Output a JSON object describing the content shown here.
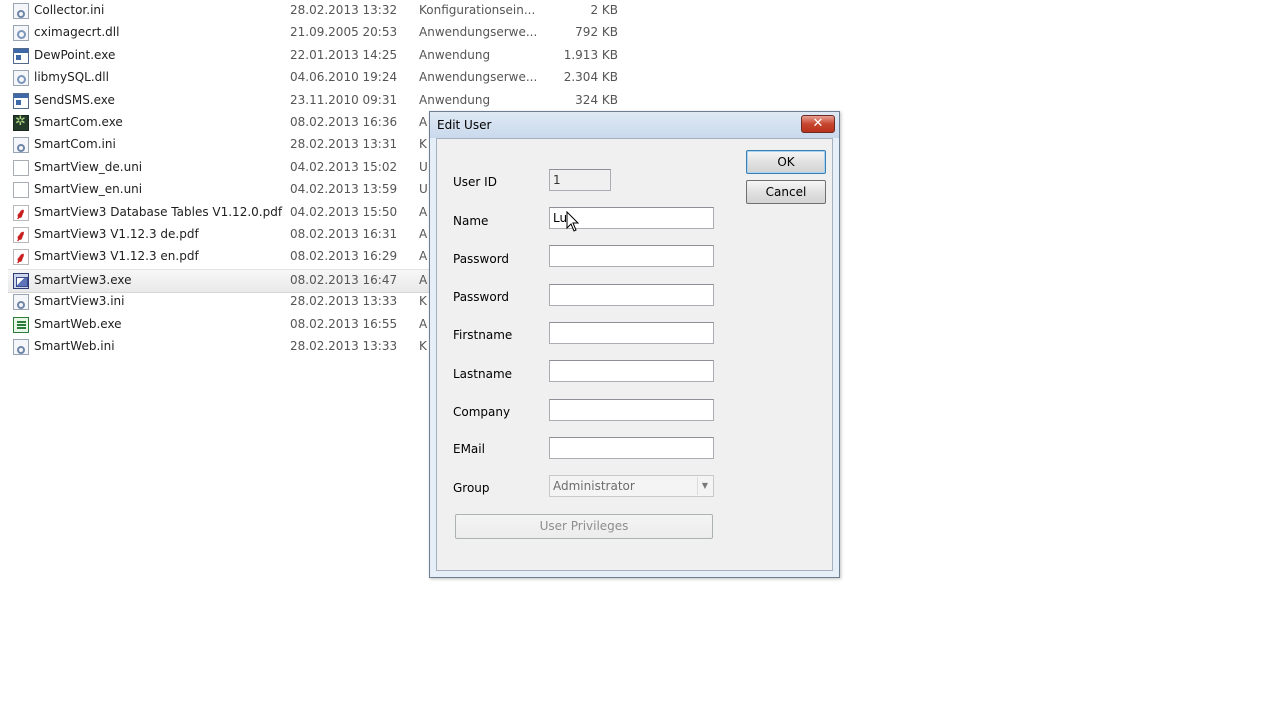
{
  "files": [
    {
      "name": "Collector.ini",
      "date": "28.02.2013 13:32",
      "type": "Konfigurationsein...",
      "size": "2 KB",
      "icon": "ini-file-icon"
    },
    {
      "name": "cximagecrt.dll",
      "date": "21.09.2005 20:53",
      "type": "Anwendungserwe...",
      "size": "792 KB",
      "icon": "dll-file-icon"
    },
    {
      "name": "DewPoint.exe",
      "date": "22.01.2013 14:25",
      "type": "Anwendung",
      "size": "1.913 KB",
      "icon": "exe-file-icon"
    },
    {
      "name": "libmySQL.dll",
      "date": "04.06.2010 19:24",
      "type": "Anwendungserwe...",
      "size": "2.304 KB",
      "icon": "dll-file-icon"
    },
    {
      "name": "SendSMS.exe",
      "date": "23.11.2010 09:31",
      "type": "Anwendung",
      "size": "324 KB",
      "icon": "exe-file-icon"
    },
    {
      "name": "SmartCom.exe",
      "date": "08.02.2013 16:36",
      "type": "A",
      "size": "",
      "icon": "smartcom-app-icon"
    },
    {
      "name": "SmartCom.ini",
      "date": "28.02.2013 13:31",
      "type": "K",
      "size": "",
      "icon": "ini-file-icon"
    },
    {
      "name": "SmartView_de.uni",
      "date": "04.02.2013 15:02",
      "type": "U",
      "size": "",
      "icon": "uni-file-icon"
    },
    {
      "name": "SmartView_en.uni",
      "date": "04.02.2013 13:59",
      "type": "U",
      "size": "",
      "icon": "uni-file-icon"
    },
    {
      "name": "SmartView3 Database Tables V1.12.0.pdf",
      "date": "04.02.2013 15:50",
      "type": "A",
      "size": "",
      "icon": "pdf-file-icon"
    },
    {
      "name": "SmartView3 V1.12.3 de.pdf",
      "date": "08.02.2013 16:31",
      "type": "A",
      "size": "",
      "icon": "pdf-file-icon"
    },
    {
      "name": "SmartView3 V1.12.3 en.pdf",
      "date": "08.02.2013 16:29",
      "type": "A",
      "size": "",
      "icon": "pdf-file-icon"
    },
    {
      "name": "SmartView3.exe",
      "date": "08.02.2013 16:47",
      "type": "A",
      "size": "",
      "icon": "smartview-app-icon",
      "selected": true
    },
    {
      "name": "SmartView3.ini",
      "date": "28.02.2013 13:33",
      "type": "K",
      "size": "",
      "icon": "ini-file-icon"
    },
    {
      "name": "SmartWeb.exe",
      "date": "08.02.2013 16:55",
      "type": "A",
      "size": "",
      "icon": "smartweb-app-icon"
    },
    {
      "name": "SmartWeb.ini",
      "date": "28.02.2013 13:33",
      "type": "K",
      "size": "",
      "icon": "ini-file-icon"
    }
  ],
  "dialog": {
    "title": "Edit User",
    "close_symbol": "✕",
    "ok_label": "OK",
    "cancel_label": "Cancel",
    "labels": {
      "user_id": "User ID",
      "name": "Name",
      "password": "Password",
      "password_confirm": "Password",
      "firstname": "Firstname",
      "lastname": "Lastname",
      "company": "Company",
      "email": "EMail",
      "group": "Group"
    },
    "values": {
      "user_id": "1",
      "name": "Lu",
      "password": "",
      "password_confirm": "",
      "firstname": "",
      "lastname": "",
      "company": "",
      "email": "",
      "group": "Administrator"
    },
    "group_arrow": "▼",
    "user_privileges_label": "User Privileges"
  },
  "colors": {
    "dialog_frame": "#e6eef7",
    "close_button": "#c7452f",
    "selected_row": "#e9e9e9"
  }
}
